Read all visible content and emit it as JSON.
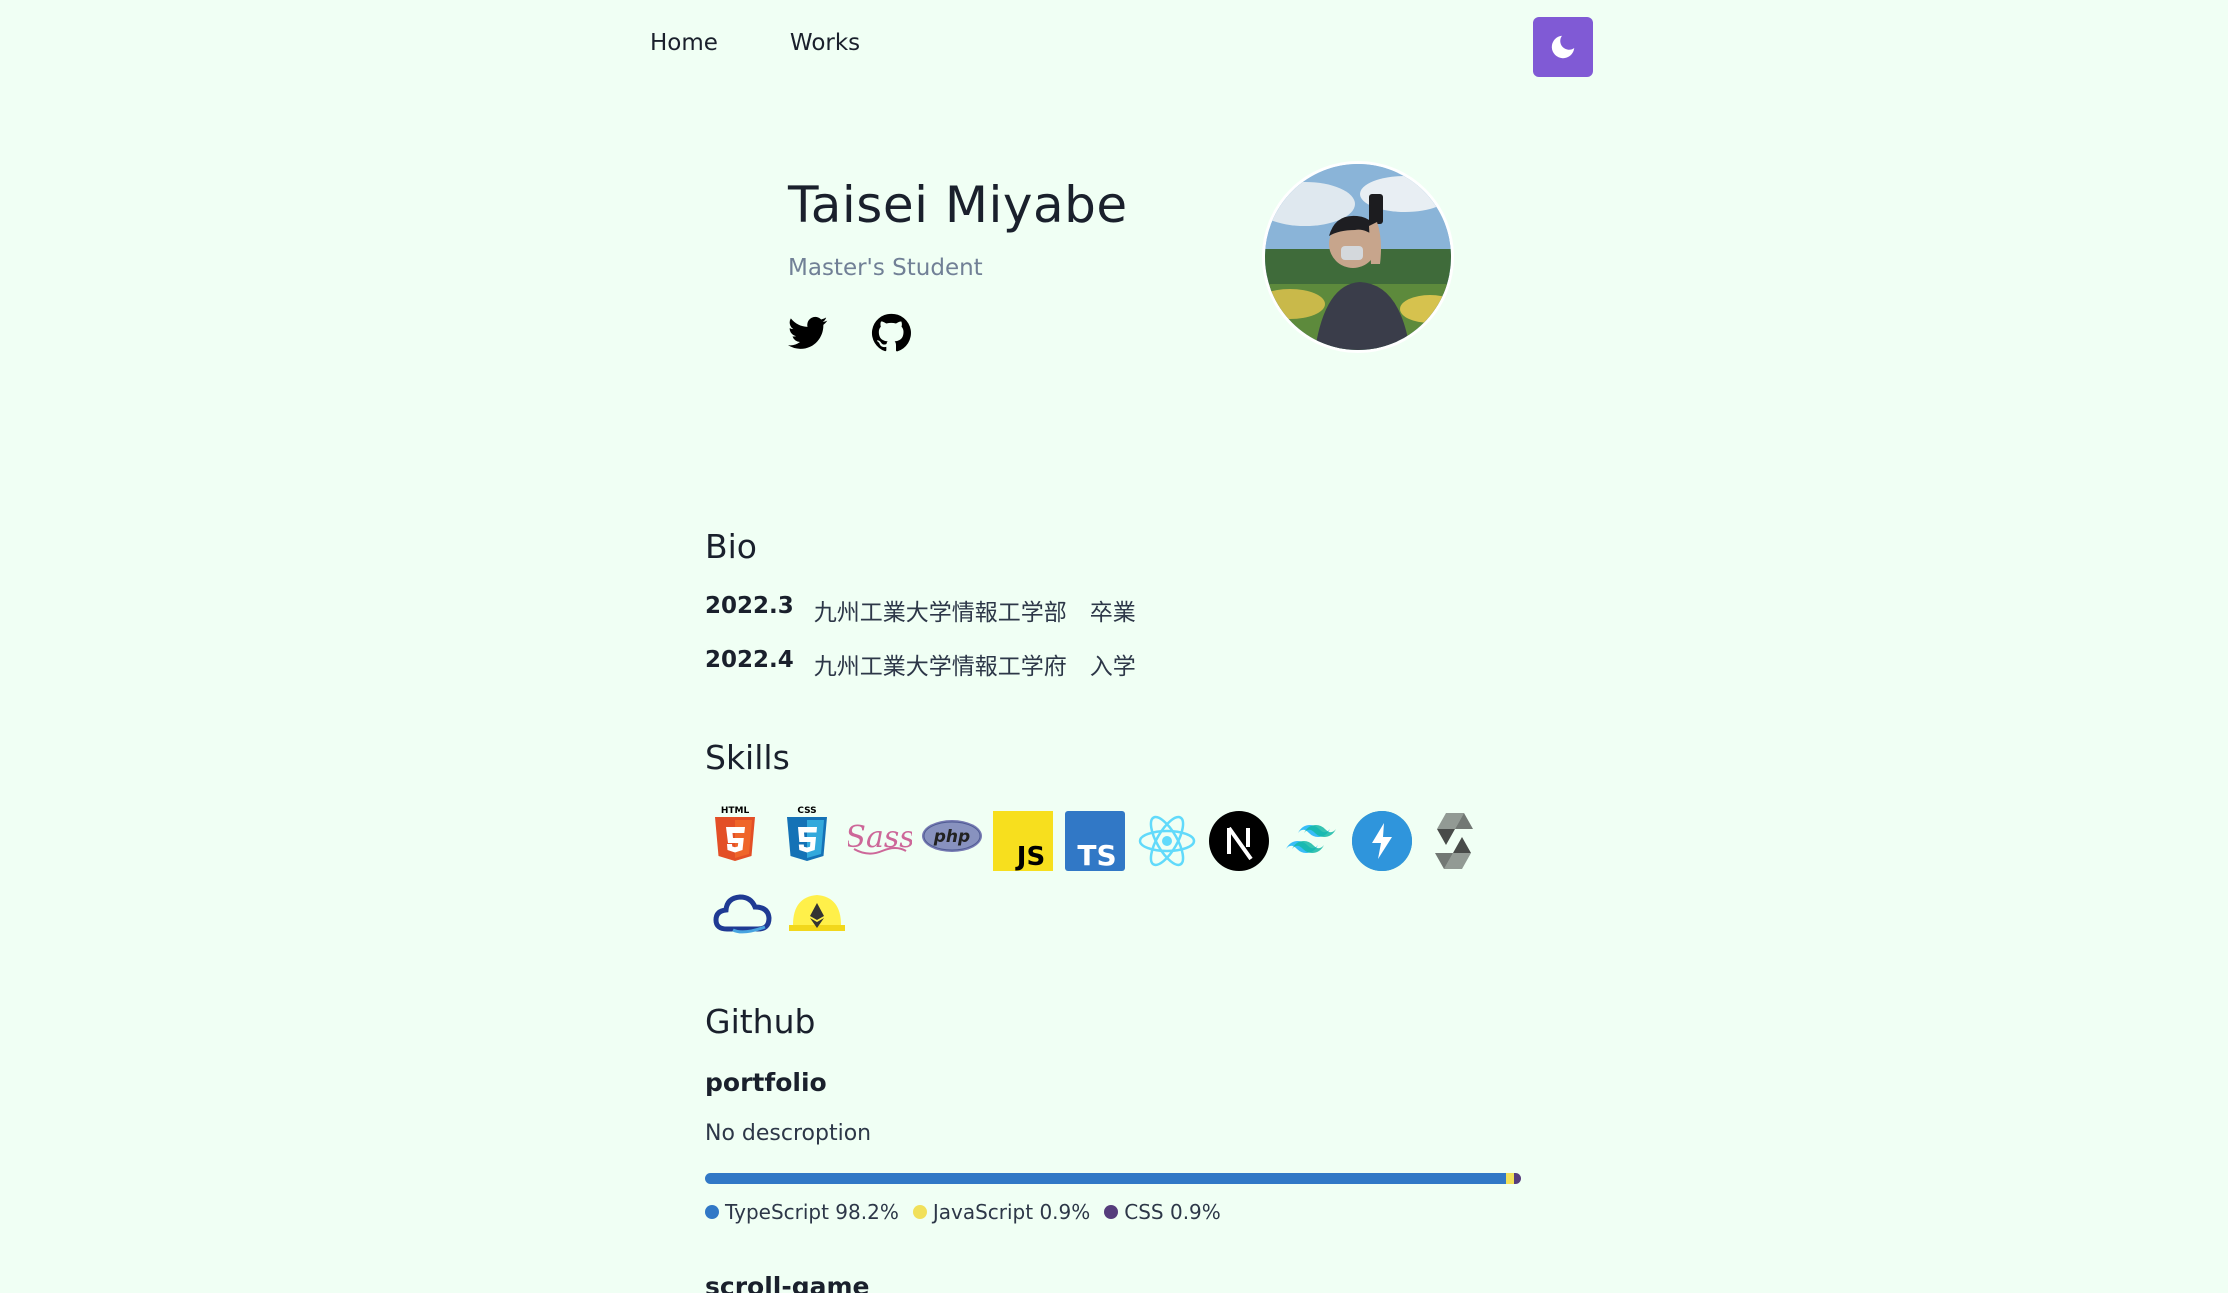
{
  "nav": {
    "items": [
      {
        "label": "Home"
      },
      {
        "label": "Works"
      }
    ],
    "theme_toggle_icon": "moon-icon",
    "accent_color": "#805ad5"
  },
  "hero": {
    "name": "Taisei Miyabe",
    "role": "Master's Student",
    "socials": [
      {
        "icon": "twitter-icon"
      },
      {
        "icon": "github-icon"
      }
    ]
  },
  "bio": {
    "title": "Bio",
    "entries": [
      {
        "year": "2022.3",
        "text": "九州工業大学情報工学部　卒業"
      },
      {
        "year": "2022.4",
        "text": "九州工業大学情報工学府　入学"
      }
    ]
  },
  "skills": {
    "title": "Skills",
    "icons": [
      "html5-icon",
      "css3-icon",
      "sass-icon",
      "php-icon",
      "javascript-icon",
      "typescript-icon",
      "react-icon",
      "nextjs-icon",
      "tailwind-icon",
      "chakra-icon",
      "solidity-icon",
      "cloud-icon",
      "hardhat-icon"
    ],
    "labels": {
      "html": "HTML",
      "css": "CSS",
      "sass": "Sass",
      "php": "php",
      "js": "JS",
      "ts": "TS"
    }
  },
  "github": {
    "title": "Github",
    "repos": [
      {
        "name": "portfolio",
        "description": "No descroption",
        "languages": [
          {
            "name": "TypeScript",
            "percent": 98.2,
            "label": "TypeScript 98.2%",
            "color": "#3178c6"
          },
          {
            "name": "JavaScript",
            "percent": 0.9,
            "label": "JavaScript 0.9%",
            "color": "#f1e05a"
          },
          {
            "name": "CSS",
            "percent": 0.9,
            "label": "CSS 0.9%",
            "color": "#563d7c"
          }
        ]
      },
      {
        "name": "scroll-game"
      }
    ]
  }
}
